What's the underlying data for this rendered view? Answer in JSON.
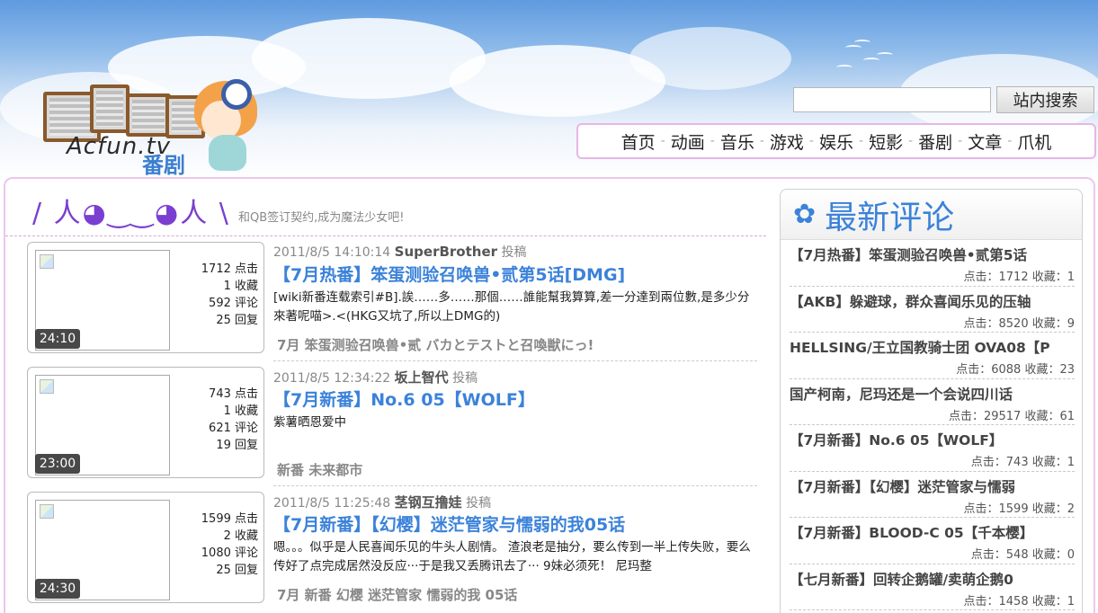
{
  "search": {
    "placeholder": "",
    "button_label": "站内搜索"
  },
  "logo": {
    "text": "Acfun.tv",
    "sub": "番剧"
  },
  "nav": [
    "首页",
    "动画",
    "音乐",
    "游戏",
    "娱乐",
    "短影",
    "番剧",
    "文章",
    "爪机"
  ],
  "slogan": {
    "face": "/ 人◕‿‿◕人 \\",
    "text": "和QB签订契约,成为魔法少女吧!"
  },
  "posts": [
    {
      "duration": "24:10",
      "stats": [
        "1712 点击",
        "1 收藏",
        "592 评论",
        "25 回复"
      ],
      "time": "2011/8/5 14:10:14",
      "author": "SuperBrother",
      "action": "投稿",
      "title": "【7月热番】笨蛋测验召唤兽•贰第5话[DMG]",
      "desc": "[wiki新番连载索引#B].誒……多……那個……誰能幫我算算,差一分達到兩位數,是多少分來著呢喵>.<(HKG又坑了,所以上DMG的)",
      "tags": "7月 笨蛋测验召唤兽•贰 バカとテストと召喚獣にっ!"
    },
    {
      "duration": "23:00",
      "stats": [
        "743 点击",
        "1 收藏",
        "621 评论",
        "19 回复"
      ],
      "time": "2011/8/5 12:34:22",
      "author": "坂上智代",
      "action": "投稿",
      "title": "【7月新番】No.6 05【WOLF】",
      "desc": "紫薯晒恩爱中",
      "tags": "新番 未来都市"
    },
    {
      "duration": "24:30",
      "stats": [
        "1599 点击",
        "2 收藏",
        "1080 评论",
        "25 回复"
      ],
      "time": "2011/8/5 11:25:48",
      "author": "茎钢互撸娃",
      "action": "投稿",
      "title": "【7月新番】【幻樱】迷茫管家与懦弱的我05话",
      "desc": "嗯。。。似乎是人民喜闻乐见的牛头人剧情。 渣浪老是抽分，要么传到一半上传失败，要么传好了点完成居然没反应···于是我又丢腾讯去了··· 9妹必须死！ 尼玛整",
      "tags": "7月 新番 幻樱 迷茫管家 懦弱的我 05话"
    }
  ],
  "sidebar": {
    "title": "最新评论",
    "items": [
      {
        "title": "【7月热番】笨蛋测验召唤兽•贰第5话",
        "stats": "点击：1712 收藏：1"
      },
      {
        "title": "【AKB】躲避球，群众喜闻乐见的压轴",
        "stats": "点击：8520 收藏：9"
      },
      {
        "title": "HELLSING/王立国教骑士团 OVA08【P",
        "stats": "点击：6088 收藏：23"
      },
      {
        "title": "国产柯南，尼玛还是一个会说四川话",
        "stats": "点击：29517 收藏：61"
      },
      {
        "title": "【7月新番】No.6 05【WOLF】",
        "stats": "点击：743 收藏：1"
      },
      {
        "title": "【7月新番】【幻樱】迷茫管家与懦弱",
        "stats": "点击：1599 收藏：2"
      },
      {
        "title": "【7月新番】BLOOD-C 05【千本樱】",
        "stats": "点击：548 收藏：0"
      },
      {
        "title": "【七月新番】回转企鹅罐/卖萌企鹅0",
        "stats": "点击：1458 收藏：1"
      }
    ]
  }
}
